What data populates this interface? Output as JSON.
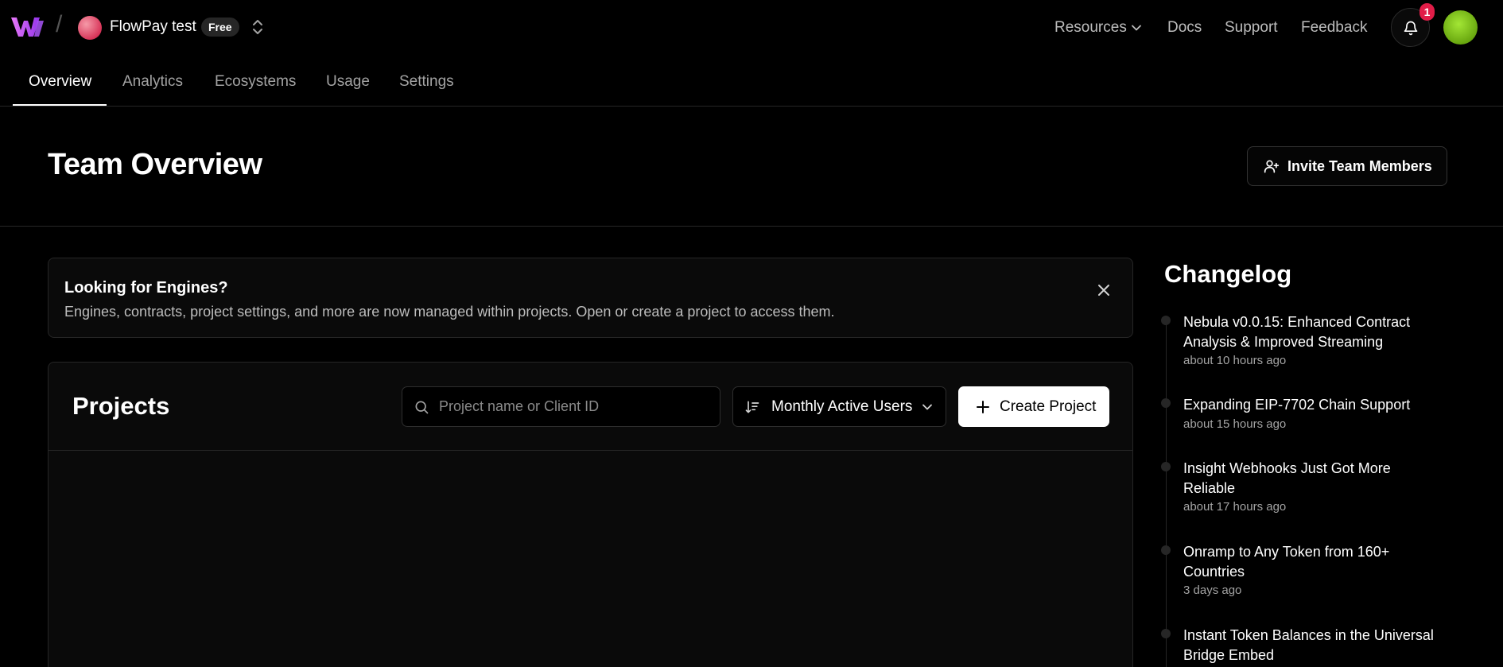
{
  "header": {
    "team_name": "FlowPay test",
    "plan_badge": "Free",
    "links": {
      "resources": "Resources",
      "docs": "Docs",
      "support": "Support",
      "feedback": "Feedback"
    },
    "notification_count": "1"
  },
  "tabs": [
    {
      "label": "Overview",
      "active": true
    },
    {
      "label": "Analytics"
    },
    {
      "label": "Ecosystems"
    },
    {
      "label": "Usage"
    },
    {
      "label": "Settings"
    }
  ],
  "page": {
    "title": "Team Overview",
    "invite_label": "Invite Team Members"
  },
  "banner": {
    "title": "Looking for Engines?",
    "text": "Engines, contracts, project settings, and more are now managed within projects. Open or create a project to access them."
  },
  "projects": {
    "title": "Projects",
    "search_placeholder": "Project name or Client ID",
    "sort_label": "Monthly Active Users",
    "create_label": "Create Project"
  },
  "changelog": {
    "title": "Changelog",
    "items": [
      {
        "title": "Nebula v0.0.15: Enhanced Contract Analysis & Improved Streaming",
        "time": "about 10 hours ago"
      },
      {
        "title": "Expanding EIP-7702 Chain Support",
        "time": "about 15 hours ago"
      },
      {
        "title": "Insight Webhooks Just Got More Reliable",
        "time": "about 17 hours ago"
      },
      {
        "title": "Onramp to Any Token from 160+ Countries",
        "time": "3 days ago"
      },
      {
        "title": "Instant Token Balances in the Universal Bridge Embed",
        "time": ""
      }
    ]
  },
  "colors": {
    "background": "#000000",
    "panel": "#0a0a0a",
    "border": "#262626",
    "notification": "#e11d48",
    "brand": "#c026d3"
  }
}
